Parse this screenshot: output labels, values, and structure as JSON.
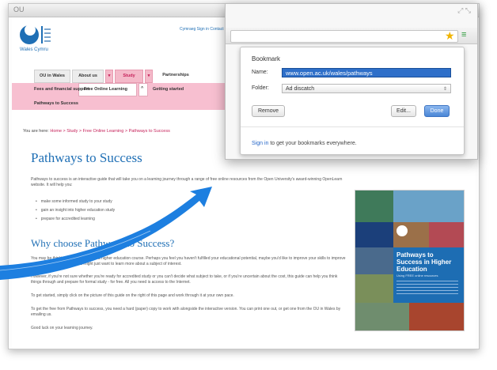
{
  "browser": {
    "window_title": "OU",
    "url": "www.open.ac.uk/wales/pathways"
  },
  "site": {
    "region_label": "Wales Cymru",
    "top_links": "Cymraeg  Sign in  Contact us",
    "nav": [
      "OU in Wales",
      "About us",
      "Study",
      "Partnerships"
    ],
    "subnav": [
      "Fees and financial support",
      "Free Online Learning",
      "Getting started"
    ],
    "subnav_active": "Pathways to Success"
  },
  "breadcrumb": {
    "prefix": "You are here:",
    "trail": "Home  >  Study  >  Free Online Learning  >  Pathways to Success"
  },
  "content": {
    "title": "Pathways to Success",
    "intro": "Pathways to success is an interactive guide that will take you on a learning journey through a range of free online resources from the Open University's award-winning OpenLearn website. It will help you:",
    "bullets": [
      "make some informed study to your study",
      "gain an insight into higher education study",
      "prepare for accredited learning"
    ],
    "subtitle": "Why choose Pathways to Success?",
    "paragraphs": [
      "You may be thinking about starting on a higher education course. Perhaps you feel you haven't fulfilled your educational potential, maybe you'd like to improve your skills to improve your career prospects, or you might just want to learn more about a subject of interest.",
      "However, if you're not sure whether you're ready for accredited study or you can't decide what subject to take, or if you're uncertain about the cost, this guide can help you think things through and prepare for formal study - for free. All you need is access to the Internet.",
      "To get started, simply click on the picture of this guide on the right of this page and work through it at your own pace.",
      "To get the free from Pathways to success, you need a hard (paper) copy to work with alongside the interactive version. You can print one out, or get one from the OU in Wales by emailing us.",
      "Good luck on your learning journey."
    ]
  },
  "cover": {
    "title": "Pathways to Success in Higher Education",
    "subtitle": "Using FREE online resources"
  },
  "bookmark_popup": {
    "title": "Bookmark",
    "name_label": "Name:",
    "name_value": "www.open.ac.uk/wales/pathways",
    "folder_label": "Folder:",
    "folder_value": "Ad discatch",
    "remove_label": "Remove",
    "edit_label": "Edit...",
    "done_label": "Done",
    "signin_link": "Sign in",
    "signin_rest": " to get your bookmarks everywhere."
  },
  "colors": {
    "accent_blue": "#1f6fb5",
    "nav_pink": "#f7bfd0",
    "arrow_blue": "#1d7fe0"
  }
}
